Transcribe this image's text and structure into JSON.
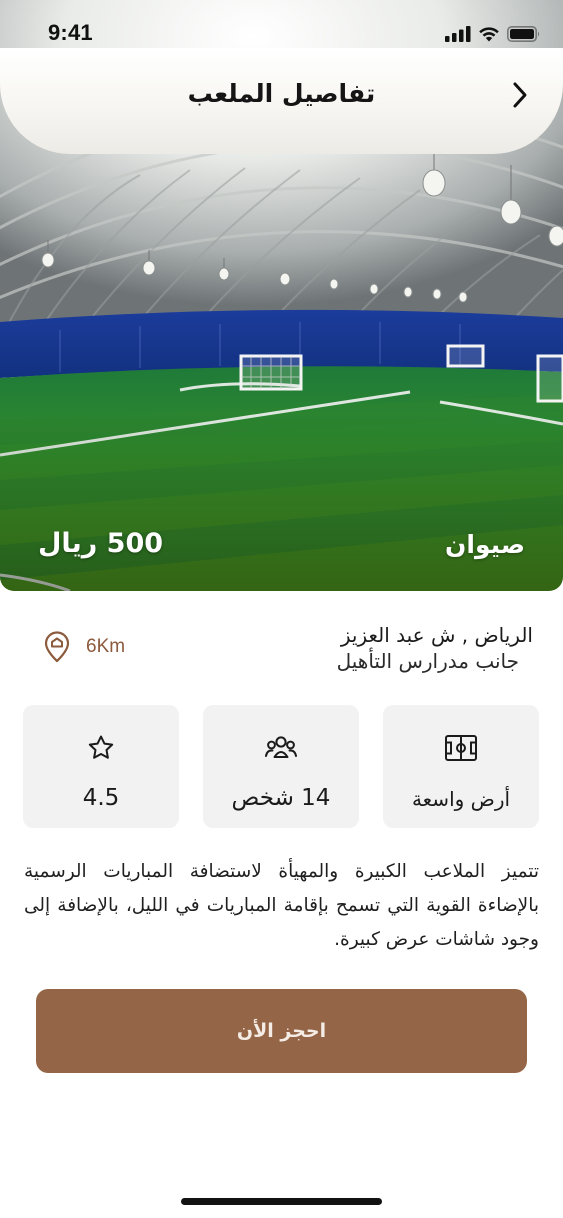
{
  "status_bar": {
    "time": "9:41",
    "icons": [
      "signal-icon",
      "wifi-icon",
      "battery-icon"
    ]
  },
  "header": {
    "title": "تفاصيل الملعب",
    "back_icon": "chevron-right-icon"
  },
  "field": {
    "name": "صيوان",
    "price": "500 ريال",
    "image_subject": "indoor-football-field-dome"
  },
  "location": {
    "line1": "الرياض , ش عبد العزيز",
    "line2": "جانب مدرارس التأهيل",
    "distance": "6Km",
    "icon": "location-pin-icon"
  },
  "features": [
    {
      "icon": "star-icon",
      "value": "4.5"
    },
    {
      "icon": "people-icon",
      "value": "14 شخص"
    },
    {
      "icon": "field-icon",
      "value": "أرض واسعة"
    }
  ],
  "description": "تتميز الملاعب الكبيرة والمهيأة لاستضافة المباريات الرسمية بالإضاءة القوية التي تسمح بإقامة المباريات في الليل، بالإضافة إلى وجود شاشات عرض كبيرة.",
  "book_button": {
    "label": "احجز الأن"
  },
  "colors": {
    "accent": "#946647",
    "distance_text": "#8c5a3c",
    "card_bg": "#f2f2f2"
  }
}
